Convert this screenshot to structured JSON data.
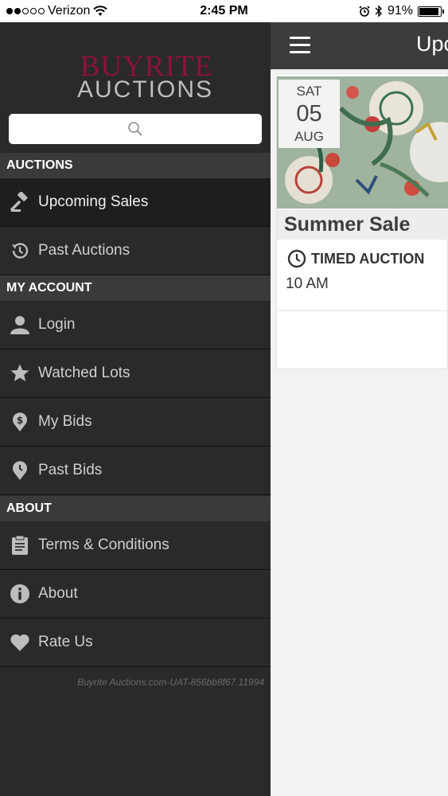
{
  "status_bar": {
    "carrier": "Verizon",
    "time": "2:45 PM",
    "battery": "91%",
    "battery_level": 0.91
  },
  "drawer": {
    "logo": {
      "line1": "BUYRITE",
      "line2": "AUCTIONS"
    },
    "search": {
      "placeholder": "",
      "icon": "search-icon"
    },
    "sections": [
      {
        "header": "AUCTIONS",
        "items": [
          {
            "label": "Upcoming Sales",
            "icon": "gavel-icon",
            "active": true
          },
          {
            "label": "Past Auctions",
            "icon": "history-icon"
          }
        ]
      },
      {
        "header": "MY ACCOUNT",
        "items": [
          {
            "label": "Login",
            "icon": "user-icon"
          },
          {
            "label": "Watched Lots",
            "icon": "star-icon"
          },
          {
            "label": "My Bids",
            "icon": "dollar-pin-icon"
          },
          {
            "label": "Past Bids",
            "icon": "clock-pin-icon"
          }
        ]
      },
      {
        "header": "ABOUT",
        "items": [
          {
            "label": "Terms & Conditions",
            "icon": "clipboard-icon"
          },
          {
            "label": "About",
            "icon": "info-icon"
          },
          {
            "label": "Rate Us",
            "icon": "heart-icon"
          }
        ]
      }
    ],
    "version": "Buyrite Auctions.com-UAT-856bb8f67.11994"
  },
  "main": {
    "nav_title": "Upcoming Sales",
    "card": {
      "weekday": "SAT",
      "day": "05",
      "month": "AUG",
      "title": "Summer Sale",
      "type": "TIMED AUCTION",
      "time": "10 AM"
    }
  }
}
